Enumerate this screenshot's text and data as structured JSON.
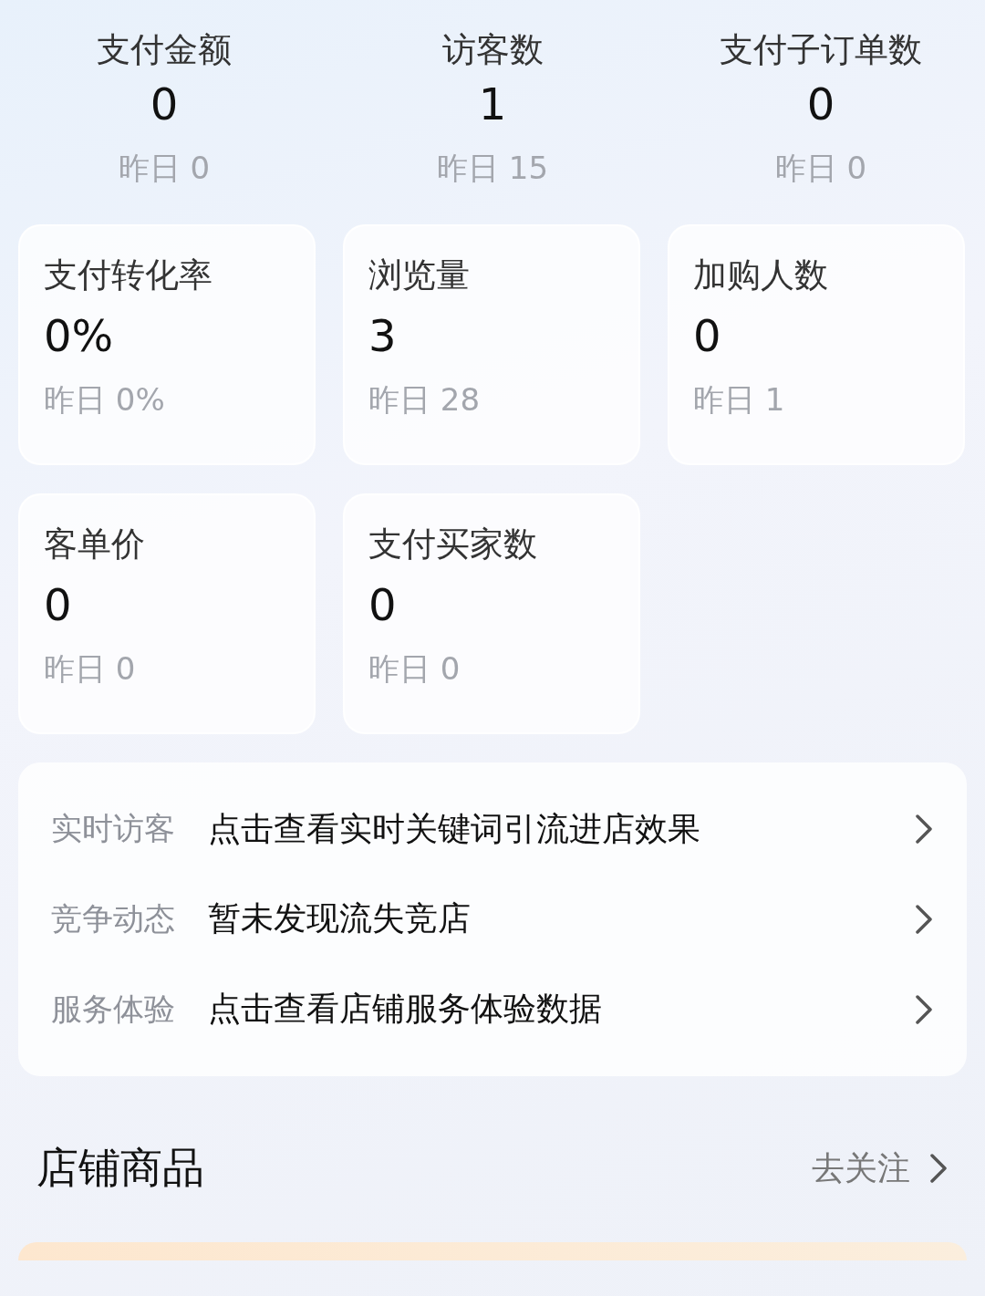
{
  "top_stats": [
    {
      "label": "支付金额",
      "value": "0",
      "yesterday": "昨日 0"
    },
    {
      "label": "访客数",
      "value": "1",
      "yesterday": "昨日 15"
    },
    {
      "label": "支付子订单数",
      "value": "0",
      "yesterday": "昨日 0"
    }
  ],
  "cards": [
    {
      "label": "支付转化率",
      "value": "0%",
      "yesterday": "昨日 0%"
    },
    {
      "label": "浏览量",
      "value": "3",
      "yesterday": "昨日 28"
    },
    {
      "label": "加购人数",
      "value": "0",
      "yesterday": "昨日 1"
    },
    {
      "label": "客单价",
      "value": "0",
      "yesterday": "昨日 0"
    },
    {
      "label": "支付买家数",
      "value": "0",
      "yesterday": "昨日 0"
    }
  ],
  "insights": [
    {
      "label": "实时访客",
      "text": "点击查看实时关键词引流进店效果"
    },
    {
      "label": "竞争动态",
      "text": "暂未发现流失竞店"
    },
    {
      "label": "服务体验",
      "text": "点击查看店铺服务体验数据"
    }
  ],
  "section": {
    "title": "店铺商品",
    "action": "去关注"
  }
}
